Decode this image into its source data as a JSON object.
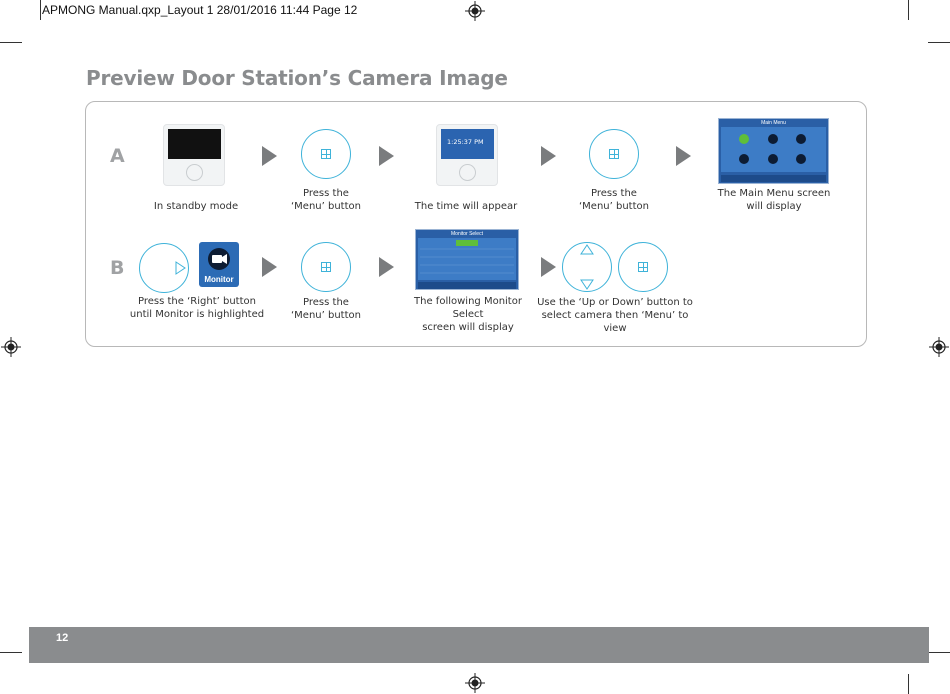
{
  "slug": "APMONG Manual.qxp_Layout 1  28/01/2016  11:44  Page 12",
  "title": "Preview Door Station’s Camera Image",
  "rows": {
    "a": {
      "label": "A",
      "captions": [
        "In standby mode",
        "Press the\n‘Menu’ button",
        "The time will appear",
        "Press the\n‘Menu’ button",
        "The Main Menu screen\nwill display"
      ]
    },
    "b": {
      "label": "B",
      "captions": [
        "Press the ‘Right’ button\nuntil Monitor is highlighted",
        "Press the\n‘Menu’ button",
        "The following Monitor Select\nscreen will display",
        "Use the ‘Up or Down’ button to\nselect camera then ‘Menu’ to view"
      ]
    }
  },
  "screens": {
    "time": "1:25:37 PM",
    "main_menu_title": "Main Menu",
    "monitor_select_title": "Monitor Select",
    "monitor_icon_label": "Monitor"
  },
  "page_number": "12",
  "colors": {
    "accent": "#3fb3d9",
    "footer": "#8a8c8e",
    "title": "#8a8c8e",
    "arrow": "#7a7c7e"
  }
}
